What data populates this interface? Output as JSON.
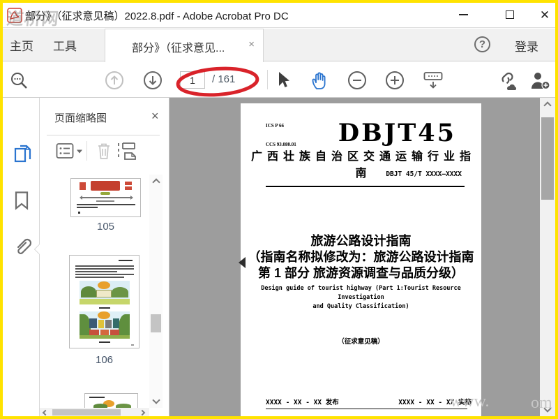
{
  "window": {
    "title": "部分》（征求意见稿）2022.8.pdf - Adobe Acrobat Pro DC",
    "watermark": "道桥网"
  },
  "tabbar": {
    "home": "主页",
    "tools": "工具",
    "document_tab": "部分》（征求意见...",
    "tab_close_glyph": "×",
    "help_glyph": "?",
    "sign_in": "登录"
  },
  "toolbar": {
    "page_current": "1",
    "page_total_label": "/ 161"
  },
  "panel": {
    "title": "页面缩略图",
    "close_glyph": "×",
    "pages": [
      {
        "label": "105"
      },
      {
        "label": "106"
      }
    ]
  },
  "page": {
    "ics": "ICS P 66",
    "ccs": "CCS 93.080.01",
    "code": "DBJT45",
    "org": "广西壮族自治区交通运输行业指南",
    "number": "DBJT 45/T XXXX—XXXX",
    "title1": "旅游公路设计指南",
    "title2": "（指南名称拟修改为：旅游公路设计指南",
    "title3": "第 1 部分  旅游资源调查与品质分级）",
    "en1": "Design guide of tourist highway (Part 1:Tourist Resource Investigation",
    "en2": "and Quality Classification)",
    "draft": "（征求意见稿）",
    "issue": "XXXX - XX - XX 发布",
    "impl": "XXXX - XX - XX 实施"
  },
  "watermark_bottom": {
    "prefix": "www.",
    "suffix": "om"
  },
  "colors": {
    "frame": "#ffe300",
    "accent": "#2a74cf",
    "annotation": "#d9232a"
  }
}
